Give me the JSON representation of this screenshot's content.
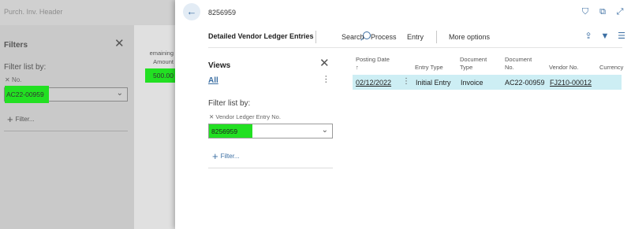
{
  "background": {
    "header_title": "Purch. Inv. Header",
    "filters_title": "Filters",
    "filter_list_by": "Filter list by:",
    "field_label": "No.",
    "field_value": "AC22-00959",
    "add_filter": "Filter...",
    "column_header": "emaining Amount",
    "amount_value": "500.00"
  },
  "panel": {
    "record_no": "8256959",
    "toolbar": {
      "title": "Detailed Vendor Ledger Entries",
      "search": "Search",
      "process": "Process",
      "entry": "Entry",
      "more_options": "More options"
    },
    "views": {
      "title": "Views",
      "all": "All",
      "filter_list_by": "Filter list by:",
      "field_label": "Vendor Ledger Entry No.",
      "field_value": "8256959",
      "add_filter": "Filter..."
    },
    "table": {
      "headers": {
        "posting_date": "Posting Date",
        "entry_type": "Entry Type",
        "document_type": "Document Type",
        "document_no": "Document No.",
        "vendor_no": "Vendor No.",
        "currency": "Currency"
      },
      "rows": [
        {
          "posting_date": "02/12/2022",
          "entry_type": "Initial Entry",
          "document_type": "Invoice",
          "document_no": "AC22-00959",
          "vendor_no": "FJ210-00012"
        }
      ]
    }
  },
  "colors": {
    "highlight": "#22e022",
    "accent": "#3c6fa3",
    "row_selected": "#cdeef4"
  }
}
